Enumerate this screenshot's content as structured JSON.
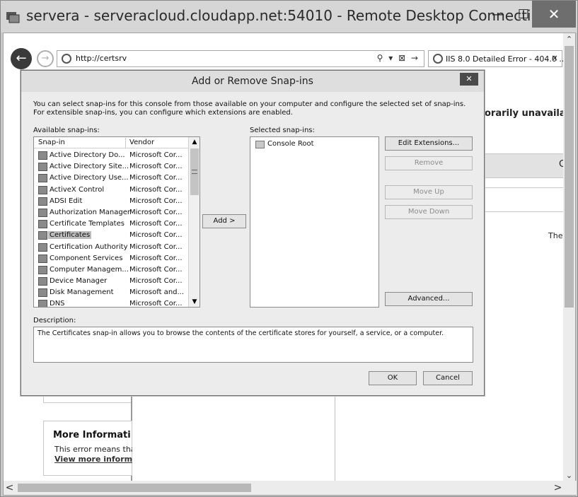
{
  "window": {
    "title": "servera - serveracloud.cloudapp.net:54010 - Remote Desktop Connecti...",
    "minimize_glyph": "—",
    "maximize_glyph": "☐",
    "close_glyph": "✕"
  },
  "browser": {
    "back_glyph": "←",
    "forward_glyph": "→",
    "address": "http://certsrv",
    "address_tools": "⚲ ▾ ⊠ →",
    "tab_label": "IIS 8.0 Detailed Error - 404.0 ...",
    "tab_close": "×",
    "scroll_up": "⌃",
    "scroll_down": "⌄",
    "scroll_left": "<",
    "scroll_right": ">"
  },
  "background_page": {
    "unavailable_text": "orarily unavailal",
    "col_c": "C",
    "ther": "Ther",
    "more_info_title": "More Informati",
    "error_text": "This error means tha",
    "view_more_link": "View more inform"
  },
  "dialog": {
    "title": "Add or Remove Snap-ins",
    "close_glyph": "✕",
    "intro": "You can select snap-ins for this console from those available on your computer and configure the selected set of snap-ins. For extensible snap-ins, you can configure which extensions are enabled.",
    "available_label": "Available snap-ins:",
    "selected_label": "Selected snap-ins:",
    "columns": {
      "snapin": "Snap-in",
      "vendor": "Vendor"
    },
    "available": [
      {
        "name": "Active Directory Do...",
        "vendor": "Microsoft Cor...",
        "icon": "ad-domains-icon"
      },
      {
        "name": "Active Directory Site...",
        "vendor": "Microsoft Cor...",
        "icon": "ad-sites-icon"
      },
      {
        "name": "Active Directory Use...",
        "vendor": "Microsoft Cor...",
        "icon": "ad-users-icon"
      },
      {
        "name": "ActiveX Control",
        "vendor": "Microsoft Cor...",
        "icon": "activex-icon"
      },
      {
        "name": "ADSI Edit",
        "vendor": "Microsoft Cor...",
        "icon": "adsi-edit-icon"
      },
      {
        "name": "Authorization Manager",
        "vendor": "Microsoft Cor...",
        "icon": "authorization-icon"
      },
      {
        "name": "Certificate Templates",
        "vendor": "Microsoft Cor...",
        "icon": "cert-templates-icon"
      },
      {
        "name": "Certificates",
        "vendor": "Microsoft Cor...",
        "icon": "certificates-icon",
        "selected": true
      },
      {
        "name": "Certification Authority",
        "vendor": "Microsoft Cor...",
        "icon": "cert-authority-icon"
      },
      {
        "name": "Component Services",
        "vendor": "Microsoft Cor...",
        "icon": "component-services-icon"
      },
      {
        "name": "Computer Managem...",
        "vendor": "Microsoft Cor...",
        "icon": "computer-management-icon"
      },
      {
        "name": "Device Manager",
        "vendor": "Microsoft Cor...",
        "icon": "device-manager-icon"
      },
      {
        "name": "Disk Management",
        "vendor": "Microsoft and...",
        "icon": "disk-management-icon"
      },
      {
        "name": "DNS",
        "vendor": "Microsoft Cor...",
        "icon": "dns-icon"
      }
    ],
    "selected_root": "Console Root",
    "buttons": {
      "add": "Add >",
      "edit_extensions": "Edit Extensions...",
      "remove": "Remove",
      "move_up": "Move Up",
      "move_down": "Move Down",
      "advanced": "Advanced...",
      "ok": "OK",
      "cancel": "Cancel"
    },
    "description_label": "Description:",
    "description": "The Certificates snap-in allows you to browse the contents of the certificate stores for yourself, a service, or a computer."
  }
}
